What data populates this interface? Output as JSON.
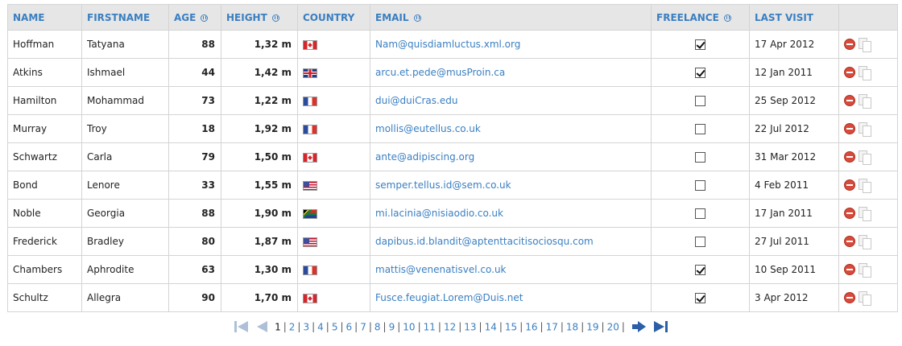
{
  "table": {
    "columns": [
      {
        "label": "NAME",
        "sortable": false
      },
      {
        "label": "FIRSTNAME",
        "sortable": false
      },
      {
        "label": "AGE",
        "sortable": true
      },
      {
        "label": "HEIGHT",
        "sortable": true
      },
      {
        "label": "COUNTRY",
        "sortable": false
      },
      {
        "label": "EMAIL",
        "sortable": true
      },
      {
        "label": "FREELANCE",
        "sortable": true
      },
      {
        "label": "LAST VISIT",
        "sortable": false
      },
      {
        "label": "",
        "sortable": false
      }
    ],
    "rows": [
      {
        "name": "Hoffman",
        "firstname": "Tatyana",
        "age": "88",
        "height": "1,32 m",
        "country": "ca-flag-icon",
        "email": "Nam@quisdiamluctus.xml.org",
        "freelance": true,
        "last_visit": "17 Apr 2012"
      },
      {
        "name": "Atkins",
        "firstname": "Ishmael",
        "age": "44",
        "height": "1,42 m",
        "country": "gb-flag-icon",
        "email": "arcu.et.pede@musProin.ca",
        "freelance": true,
        "last_visit": "12 Jan 2011"
      },
      {
        "name": "Hamilton",
        "firstname": "Mohammad",
        "age": "73",
        "height": "1,22 m",
        "country": "fr-flag-icon",
        "email": "dui@duiCras.edu",
        "freelance": false,
        "last_visit": "25 Sep 2012"
      },
      {
        "name": "Murray",
        "firstname": "Troy",
        "age": "18",
        "height": "1,92 m",
        "country": "fr-flag-icon",
        "email": "mollis@eutellus.co.uk",
        "freelance": false,
        "last_visit": "22 Jul 2012"
      },
      {
        "name": "Schwartz",
        "firstname": "Carla",
        "age": "79",
        "height": "1,50 m",
        "country": "ca-flag-icon",
        "email": "ante@adipiscing.org",
        "freelance": false,
        "last_visit": "31 Mar 2012"
      },
      {
        "name": "Bond",
        "firstname": "Lenore",
        "age": "33",
        "height": "1,55 m",
        "country": "us-flag-icon",
        "email": "semper.tellus.id@sem.co.uk",
        "freelance": false,
        "last_visit": "4 Feb 2011"
      },
      {
        "name": "Noble",
        "firstname": "Georgia",
        "age": "88",
        "height": "1,90 m",
        "country": "za-flag-icon",
        "email": "mi.lacinia@nisiaodio.co.uk",
        "freelance": false,
        "last_visit": "17 Jan 2011"
      },
      {
        "name": "Frederick",
        "firstname": "Bradley",
        "age": "80",
        "height": "1,87 m",
        "country": "us-flag-icon",
        "email": "dapibus.id.blandit@aptenttacitisociosqu.com",
        "freelance": false,
        "last_visit": "27 Jul 2011"
      },
      {
        "name": "Chambers",
        "firstname": "Aphrodite",
        "age": "63",
        "height": "1,30 m",
        "country": "fr-flag-icon",
        "email": "mattis@venenatisvel.co.uk",
        "freelance": true,
        "last_visit": "10 Sep 2011"
      },
      {
        "name": "Schultz",
        "firstname": "Allegra",
        "age": "90",
        "height": "1,70 m",
        "country": "ca-flag-icon",
        "email": "Fusce.feugiat.Lorem@Duis.net",
        "freelance": true,
        "last_visit": "3 Apr 2012"
      }
    ],
    "row_actions": [
      "delete-icon",
      "copy-icon"
    ]
  },
  "pager": {
    "current": "1",
    "pages": [
      "1",
      "2",
      "3",
      "4",
      "5",
      "6",
      "7",
      "8",
      "9",
      "10",
      "11",
      "12",
      "13",
      "14",
      "15",
      "16",
      "17",
      "18",
      "19",
      "20"
    ],
    "separator": "|",
    "icons": {
      "first": "first-page-icon",
      "prev": "prev-page-icon",
      "next": "next-page-icon",
      "last": "last-page-icon"
    }
  },
  "colors": {
    "header_bg": "#e6e6e6",
    "header_text": "#3a7fc1",
    "email_link": "#3a7fc1",
    "border": "#d4d4d4",
    "delete_red": "#d84b3c"
  }
}
